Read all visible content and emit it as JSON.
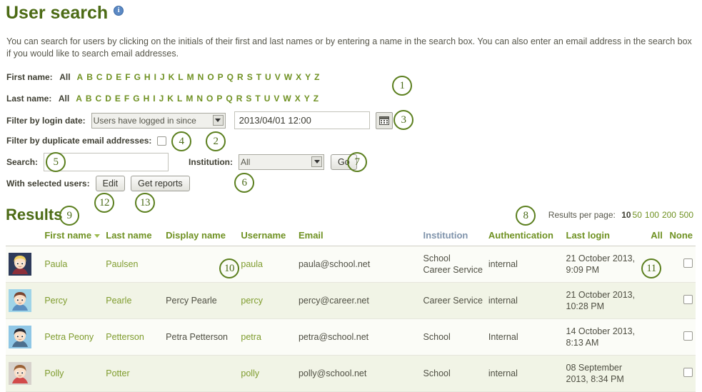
{
  "page": {
    "title": "User search",
    "info_icon": "info-icon",
    "intro": "You can search for users by clicking on the initials of their first and last names or by entering a name in the search box. You can also enter an email address in the search box if you would like to search email addresses."
  },
  "filters": {
    "first_name_label": "First name:",
    "last_name_label": "Last name:",
    "all_label": "All",
    "alphabet": [
      "A",
      "B",
      "C",
      "D",
      "E",
      "F",
      "G",
      "H",
      "I",
      "J",
      "K",
      "L",
      "M",
      "N",
      "O",
      "P",
      "Q",
      "R",
      "S",
      "T",
      "U",
      "V",
      "W",
      "X",
      "Y",
      "Z"
    ],
    "login_date_label": "Filter by login date:",
    "login_date_select": "Users have logged in since",
    "login_date_value": "2013/04/01 12:00",
    "calendar_icon": "calendar-icon",
    "duplicate_email_label": "Filter by duplicate email addresses:",
    "search_label": "Search:",
    "search_value": "",
    "search_placeholder": "",
    "institution_label": "Institution:",
    "institution_value": "All",
    "go_label": "Go",
    "with_selected_label": "With selected users:",
    "edit_label": "Edit",
    "get_reports_label": "Get reports"
  },
  "results": {
    "heading": "Results",
    "per_page_label": "Results per page:",
    "per_page_current": "10",
    "per_page_options": [
      "50",
      "100",
      "200",
      "500"
    ],
    "columns": {
      "first_name": "First name",
      "last_name": "Last name",
      "display_name": "Display name",
      "username": "Username",
      "email": "Email",
      "institution": "Institution",
      "authentication": "Authentication",
      "last_login": "Last login",
      "select_all": "All",
      "select_none": "None"
    },
    "rows": [
      {
        "first_name": "Paula",
        "last_name": "Paulsen",
        "display_name": "",
        "username": "paula",
        "email": "paula@school.net",
        "institution": "School\nCareer Service",
        "authentication": "internal",
        "last_login": "21 October 2013, 9:09 PM"
      },
      {
        "first_name": "Percy",
        "last_name": "Pearle",
        "display_name": "Percy Pearle",
        "username": "percy",
        "email": "percy@career.net",
        "institution": "Career Service",
        "authentication": "internal",
        "last_login": "21 October 2013, 10:28 PM"
      },
      {
        "first_name": "Petra Peony",
        "last_name": "Petterson",
        "display_name": "Petra Petterson",
        "username": "petra",
        "email": "petra@school.net",
        "institution": "School",
        "authentication": "Internal",
        "last_login": "14 October 2013, 8:13 AM"
      },
      {
        "first_name": "Polly",
        "last_name": "Potter",
        "display_name": "",
        "username": "polly",
        "email": "polly@school.net",
        "institution": "School",
        "authentication": "internal",
        "last_login": "08 September 2013, 8:34 PM"
      }
    ]
  },
  "annotations": [
    {
      "n": "1"
    },
    {
      "n": "2"
    },
    {
      "n": "3"
    },
    {
      "n": "4"
    },
    {
      "n": "5"
    },
    {
      "n": "6"
    },
    {
      "n": "7"
    },
    {
      "n": "8"
    },
    {
      "n": "9"
    },
    {
      "n": "10"
    },
    {
      "n": "11"
    },
    {
      "n": "12"
    },
    {
      "n": "13"
    }
  ],
  "colors": {
    "heading_green": "#4c6b15",
    "link_green": "#6f9122",
    "row_alt": "#f1f4e6",
    "annotation_green": "#5b7f1e",
    "info_blue": "#5b89c4"
  }
}
